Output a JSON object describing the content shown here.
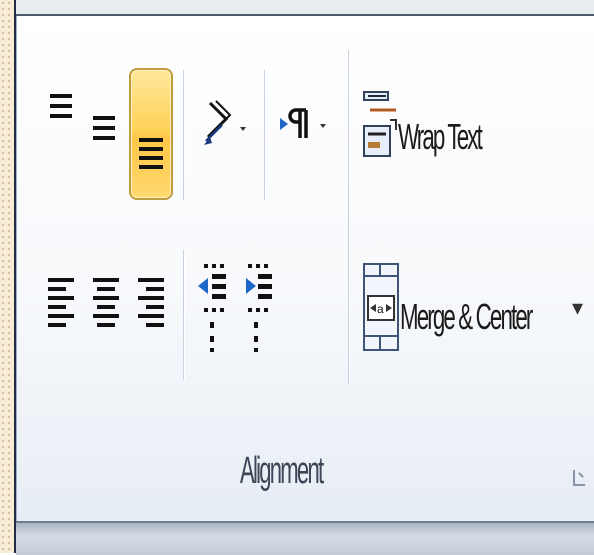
{
  "alignment_group": {
    "group_label": "Alignment",
    "wrap_text_label": "Wrap Text",
    "merge_center_label": "Merge & Center",
    "merge_center_dropdown": "▾",
    "active_button": "align-bottom",
    "accent_color": "#ffd35b",
    "icons": [
      "align-top-icon",
      "align-middle-icon",
      "align-bottom-icon",
      "orientation-icon",
      "paragraph-direction-icon",
      "wrap-text-icon",
      "align-left-icon",
      "align-center-icon",
      "align-right-icon",
      "decrease-indent-icon",
      "increase-indent-icon",
      "merge-center-icon",
      "dialog-launcher-icon"
    ]
  }
}
